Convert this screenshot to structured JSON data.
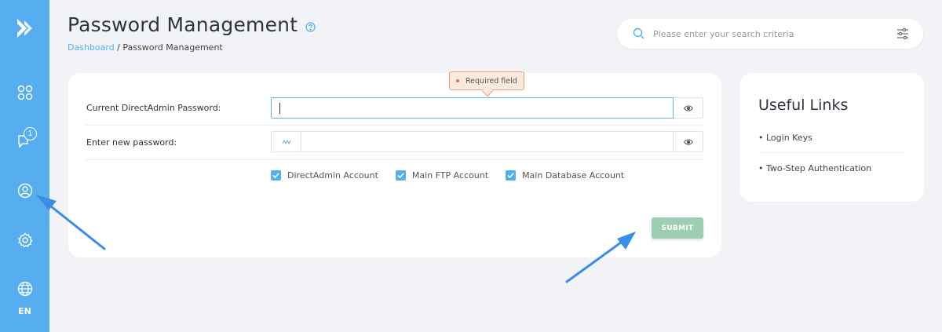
{
  "sidebar": {
    "language": "EN",
    "messages_badge": "1",
    "icons": [
      "logo-icon",
      "apps-icon",
      "messages-icon",
      "account-icon",
      "settings-icon",
      "globe-icon"
    ]
  },
  "header": {
    "title": "Password Management",
    "breadcrumb": {
      "link": "Dashboard",
      "separator": " / ",
      "current": "Password Management"
    }
  },
  "search": {
    "placeholder": "Please enter your search criteria"
  },
  "form": {
    "current_label": "Current DirectAdmin Password:",
    "new_label": "Enter new password:",
    "current_value": "",
    "new_value": "",
    "tooltip": "Required field",
    "checkboxes": [
      {
        "label": "DirectAdmin Account",
        "checked": true
      },
      {
        "label": "Main FTP Account",
        "checked": true
      },
      {
        "label": "Main Database Account",
        "checked": true
      }
    ],
    "submit_label": "SUBMIT"
  },
  "useful_links": {
    "title": "Useful Links",
    "items": [
      "• Login Keys",
      "• Two-Step Authentication"
    ]
  },
  "colors": {
    "sidebar": "#56aef0",
    "accent": "#56aef0",
    "submit": "#9ecfb3",
    "tooltip_bg": "#fbe9dd",
    "arrow": "#3b8ee8"
  }
}
